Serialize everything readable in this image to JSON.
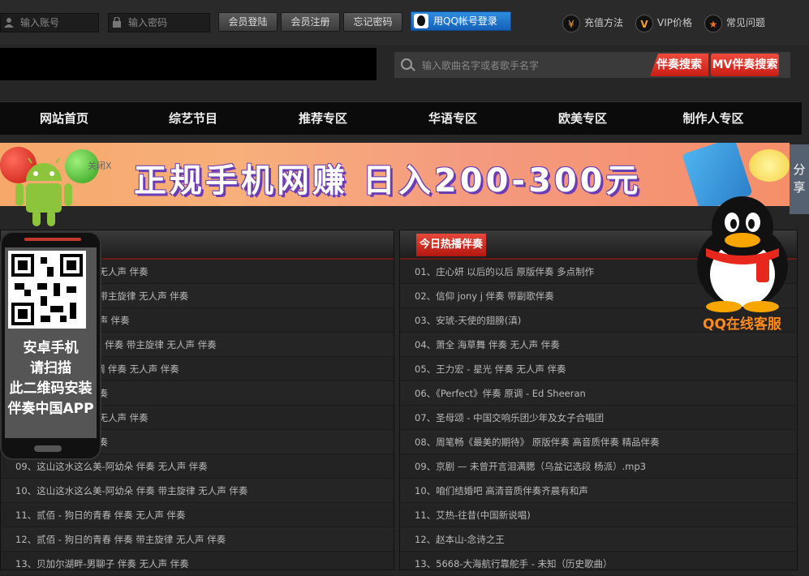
{
  "topbar": {
    "account_placeholder": "输入账号",
    "password_placeholder": "输入密码",
    "login_label": "会员登陆",
    "register_label": "会员注册",
    "forgot_label": "忘记密码",
    "qq_login_label": "用QQ帐号登录",
    "links": [
      {
        "icon": "yen-icon",
        "glyph": "¥",
        "label": "充值方法"
      },
      {
        "icon": "vip-icon",
        "glyph": "V",
        "label": "VIP价格"
      },
      {
        "icon": "star-icon",
        "glyph": "★",
        "label": "常见问题"
      }
    ]
  },
  "search": {
    "placeholder": "输入歌曲名字或者歌手名字",
    "accompaniment_button": "伴奏搜索",
    "mv_button": "MV伴奏搜索"
  },
  "nav": {
    "items": [
      "网站首页",
      "综艺节目",
      "推荐专区",
      "华语专区",
      "欧美专区",
      "制作人专区"
    ]
  },
  "banner": {
    "text": "正规手机网赚 日入200-300元",
    "close_label": "关闭X"
  },
  "share_label": "分享",
  "qr_widget": {
    "lines": [
      "安卓手机",
      "请扫描",
      "此二维码安装",
      "伴奏中国APP"
    ]
  },
  "qq_service_label": "QQ在线客服",
  "left_list": {
    "rows": [
      "01、梦想阳光 伴奏 无人声 伴奏",
      "02、梦想阳光 伴奏 带主旋律 无人声 伴奏",
      "03、无限 伴奏 无人声 伴奏",
      "04、陈果 - 风雨无阻 伴奏 带主旋律 无人声 伴奏",
      "05、心中的美丽 长调 伴奏 无人声 伴奏",
      "06、伴奏 无人声 伴奏",
      "07、伴奏 带主旋律 无人声 伴奏",
      "08、伴奏 无人声 伴奏",
      "09、这山这水这么美-阿幼朵 伴奏 无人声 伴奏",
      "10、这山这水这么美-阿幼朵 伴奏 带主旋律 无人声 伴奏",
      "11、贰佰 - 狗日的青春 伴奏 无人声 伴奏",
      "12、贰佰 - 狗日的青春 伴奏 带主旋律 无人声 伴奏",
      "13、贝加尔湖畔-男聊子 伴奏 无人声 伴奏"
    ]
  },
  "right_list": {
    "title": "今日热播伴奏",
    "rows": [
      "01、庄心妍 以后的以后 原版伴奏 多点制作",
      "02、信仰 jony j 伴奏 带副歌伴奏",
      "03、安琥-天使的翅膀(滇)",
      "04、萧全 海草舞 伴奏 无人声 伴奏",
      "05、王力宏 - 星光 伴奏 无人声 伴奏",
      "06、《Perfect》伴奏 原调 - Ed Sheeran",
      "07、圣母颂 - 中国交响乐团少年及女子合唱团",
      "08、周笔畅《最美的期待》 原版伴奏 高音质伴奏 精品伴奏",
      "09、京剧 — 未曾开言泪满腮（乌盆记选段 杨派）.mp3",
      "10、咱们结婚吧 高清音质伴奏齐晨有和声",
      "11、艾热-往昔(中国新说唱)",
      "12、赵本山-念诗之王",
      "13、5668-大海航行靠舵手 - 未知（历史歌曲）"
    ]
  }
}
